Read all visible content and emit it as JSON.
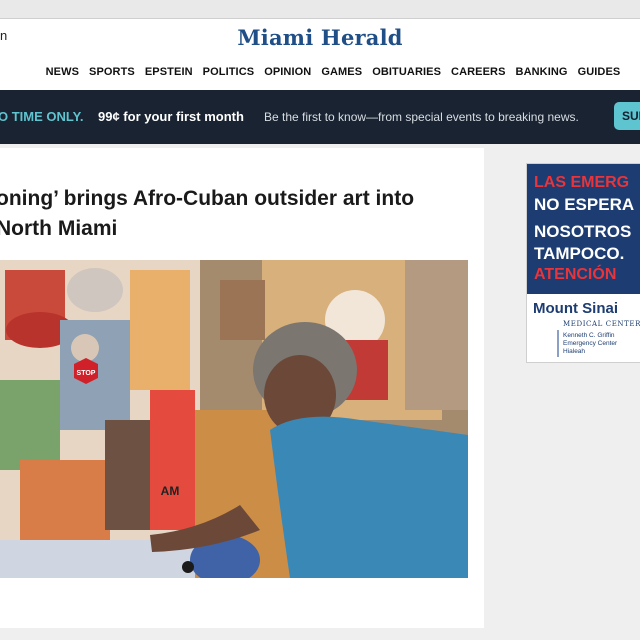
{
  "header": {
    "left_glyph": "n",
    "logo_text": "Miami Herald"
  },
  "nav": {
    "items": [
      "NEWS",
      "SPORTS",
      "EPSTEIN",
      "POLITICS",
      "OPINION",
      "GAMES",
      "OBITUARIES",
      "CAREERS",
      "BANKING",
      "GUIDES"
    ]
  },
  "promo": {
    "limited": "O TIME ONLY.",
    "offer": "99¢ for your first month",
    "tagline": "Be the first to know—from special events to breaking news.",
    "cta": "SUB",
    "accent_color": "#5ec4cf"
  },
  "article": {
    "headline": "oning’ brings Afro-Cuban outsider art into\nNorth Miami",
    "photo_sign_text": "STOP",
    "photo_collage_text": "AM"
  },
  "ad": {
    "line1": "LAS EMERG",
    "line2": "NO ESPERA",
    "line3": "NOSOTROS",
    "line4": "TAMPOCO.",
    "line5": "ATENCIÓN",
    "brand": "Mount Sinai",
    "brand_sub": "MEDICAL CENTER",
    "center_line1": "Kenneth C. Griffin",
    "center_line2": "Emergency Center",
    "center_line3": "Hialeah",
    "brand_color": "#1d3d72",
    "alert_color": "#e8343a"
  }
}
